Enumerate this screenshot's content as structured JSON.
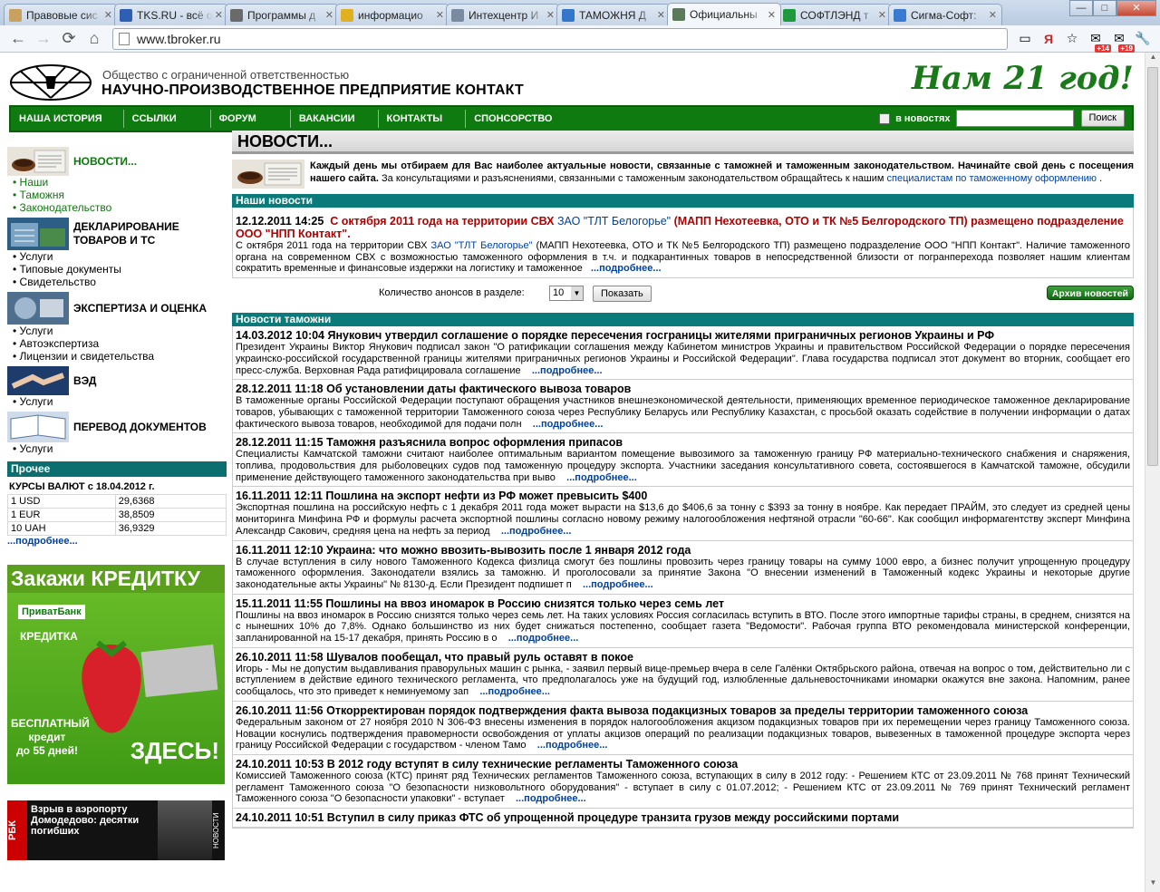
{
  "browser": {
    "tabs": [
      {
        "title": "Правовые сис",
        "color": "#c8a060"
      },
      {
        "title": "TKS.RU - всё о",
        "color": "#2e5fb3"
      },
      {
        "title": "Программы д",
        "color": "#6a6a6a"
      },
      {
        "title": "информацио",
        "color": "#e0b020"
      },
      {
        "title": "Интехцентр И",
        "color": "#7a8aa0"
      },
      {
        "title": "ТАМОЖНЯ Д",
        "color": "#3377cc"
      },
      {
        "title": "Официальны",
        "color": "#5a7a5a"
      },
      {
        "title": "СОФТЛЭНД т",
        "color": "#1c9a3c"
      },
      {
        "title": "Сигма-Софт:",
        "color": "#3a7ad0"
      }
    ],
    "url": "www.tbroker.ru",
    "badges": [
      "+14",
      "+19"
    ]
  },
  "header": {
    "org_type": "Общество с ограниченной ответственностью",
    "org_name": "НАУЧНО-ПРОИЗВОДСТВЕННОЕ ПРЕДПРИЯТИЕ КОНТАКТ",
    "slogan": "Нам 21 год!"
  },
  "menu": {
    "items": [
      "НАША ИСТОРИЯ",
      "ССЫЛКИ",
      "ФОРУМ",
      "ВАКАНСИИ",
      "КОНТАКТЫ",
      "СПОНСОРСТВО"
    ],
    "search_label": "в новостях",
    "search_button": "Поиск"
  },
  "sidebar": {
    "news_title": "НОВОСТИ...",
    "news_links": [
      "Наши",
      "Таможня",
      "Законодательство"
    ],
    "decl_title": "ДЕКЛАРИРОВАНИЕ ТОВАРОВ И ТС",
    "decl_links": [
      "Услуги",
      "Типовые документы",
      "Свидетельство"
    ],
    "exp_title": "ЭКСПЕРТИЗА И ОЦЕНКА",
    "exp_links": [
      "Услуги",
      "Автоэкспертиза",
      "Лицензии и свидетельства"
    ],
    "ved_title": "ВЭД",
    "ved_links": [
      "Услуги"
    ],
    "trans_title": "ПЕРЕВОД ДОКУМЕНТОВ",
    "trans_links": [
      "Услуги"
    ],
    "other_title": "Прочее",
    "rates_title": "КУРСЫ ВАЛЮТ с 18.04.2012 г.",
    "rates": [
      {
        "cur": "1 USD",
        "val": "29,6368"
      },
      {
        "cur": "1 EUR",
        "val": "38,8509"
      },
      {
        "cur": "10 UAH",
        "val": "36,9329"
      }
    ],
    "more": "...подробнее...",
    "ad1": {
      "title": "Закажи КРЕДИТКУ",
      "bank": "ПриватБанк",
      "card": "КРЕДИТКА",
      "free1": "БЕСПЛАТНЫЙ",
      "free2": "кредит",
      "free3": "до 55 дней!",
      "here": "ЗДЕСЬ!"
    },
    "ad2": {
      "brand": "РБК",
      "text": "Взрыв в аэропорту Домодедово: десятки погибших",
      "side": "НОВОСТИ"
    }
  },
  "main": {
    "title": "НОВОСТИ...",
    "intro_bold": "Каждый день мы отбираем для Вас наиболее актуальные новости, связанные с таможней и таможенным законодательством. Начинайте свой день с посещения нашего сайта.",
    "intro_rest": " За консультациями и разъяснениями, связанными с таможенным законодательством обращайтесь к нашим ",
    "intro_link": "специалистам по таможенному оформлению",
    "intro_end": " .",
    "our_news_title": "Наши новости",
    "our_news": {
      "date": "12.12.2011 14:25",
      "h1": "С октября 2011 года на территории СВХ",
      "h_link": "ЗАО \"ТЛТ Белогорье\"",
      "h2": "(МАПП Нехотеевка, ОТО и ТК №5 Белгородского ТП) размещено подразделение ООО \"НПП Контакт\".",
      "b1": "С октября 2011 года на территории СВХ ",
      "b_link": "ЗАО \"ТЛТ Белогорье\"",
      "b2": " (МАПП Нехотеевка, ОТО и ТК №5 Белгородского ТП) размещено подразделение ООО \"НПП Контакт\". Наличие таможенного органа на современном СВХ с возможностью таможенного оформления в т.ч. и подкарантинных товаров в непосредственной близости от погранперехода позволяет нашим клиентам сократить временные и финансовые издержки на логистику и таможенное",
      "more": "...подробнее..."
    },
    "count_label": "Количество анонсов в разделе:",
    "count_value": "10",
    "show_button": "Показать",
    "archive_button": "Архив новостей",
    "customs_title": "Новости таможни",
    "items": [
      {
        "h": "14.03.2012 10:04 Янукович утвердил соглашение о порядке пересечения госграницы жителями приграничных регионов Украины и РФ",
        "b": "Президент Украины Виктор Янукович подписал закон \"О ратификации соглашения между Кабинетом министров Украины и правительством Российской Федерации о порядке пересечения украинско-российской государственной границы жителями приграничных регионов Украины и Российской Федерации\". Глава государства подписал этот документ во вторник, сообщает его пресс-служба. Верховная Рада ратифицировала соглашение",
        "m": "...подробнее..."
      },
      {
        "h": "28.12.2011 11:18 Об установлении даты фактического вывоза товаров",
        "b": "В таможенные органы Российской Федерации поступают обращения участников внешнеэкономической деятельности, применяющих временное периодическое таможенное декларирование товаров, убывающих с таможенной территории Таможенного союза через Республику Беларусь или Республику Казахстан, с просьбой оказать содействие в получении информации о датах фактического вывоза товаров, необходимой для подачи полн",
        "m": "...подробнее..."
      },
      {
        "h": "28.12.2011 11:15 Таможня разъяснила вопрос оформления припасов",
        "b": "Специалисты Камчатской таможни считают наиболее оптимальным вариантом помещение вывозимого за таможенную границу РФ материально-технического снабжения и снаряжения, топлива, продовольствия для рыболовецких судов под таможенную процедуру экспорта. Участники заседания консультативного совета, состоявшегося в Камчатской таможне, обсудили применение действующего таможенного законодательства при выво",
        "m": "...подробнее..."
      },
      {
        "h": "16.11.2011 12:11 Пошлина на экспорт нефти из РФ может превысить $400",
        "b": "Экспортная пошлина на российскую нефть с 1 декабря 2011 года может вырасти на $13,6 до $406,6 за тонну с $393 за тонну в ноябре. Как передает ПРАЙМ, это следует из средней цены мониторинга Минфина РФ и формулы расчета экспортной пошлины согласно новому режиму налогообложения нефтяной отрасли \"60-66\". Как сообщил информагентству эксперт Минфина Александр Сакович, средняя цена на нефть за период",
        "m": "...подробнее..."
      },
      {
        "h": "16.11.2011 12:10 Украина: что можно ввозить-вывозить после 1 января 2012 года",
        "b": "В случае вступления в силу нового Таможенного Кодекса физлица смогут без пошлины провозить через границу товары на сумму 1000 евро, а бизнес получит упрощенную процедуру таможенного оформления. Законодатели взялись за таможню. И проголосовали за принятие Закона \"О внесении изменений в Таможенный кодекс Украины и некоторые другие законодательные акты Украины\" № 8130-д. Если Президент подпишет п",
        "m": "...подробнее..."
      },
      {
        "h": "15.11.2011 11:55 Пошлины на ввоз иномарок в Россию снизятся только через семь лет",
        "b": "Пошлины на ввоз иномарок в Россию снизятся только через семь лет. На таких условиях Россия согласилась вступить в ВТО. После этого импортные тарифы страны, в среднем, снизятся на с нынешних 10% до 7,8%. Однако большинство из них будет снижаться постепенно, сообщает газета \"Ведомости\". Рабочая группа ВТО рекомендовала министерской конференции, запланированной на 15-17 декабря, принять Россию в о",
        "m": "...подробнее..."
      },
      {
        "h": "26.10.2011 11:58 Шувалов пообещал, что правый руль оставят в покое",
        "b": "Игорь - Мы не допустим выдавливания праворульных машин с рынка, - заявил первый вице-премьер вчера в селе Галёнки Октябрьского района, отвечая на вопрос о том, действительно ли с вступлением в действие единого технического регламента, что предполагалось уже на будущий год, излюбленные дальневосточниками иномарки окажутся вне закона. Напомним, ранее сообщалось, что это приведет к неминуемому зап",
        "m": "...подробнее..."
      },
      {
        "h": "26.10.2011 11:56 Откорректирован порядок подтверждения факта вывоза подакцизных товаров за пределы территории таможенного союза",
        "b": "Федеральным законом от 27 ноября 2010 N 306-ФЗ внесены изменения в порядок налогообложения акцизом подакцизных товаров при их перемещении через границу Таможенного союза. Новации коснулись подтверждения правомерности освобождения от уплаты акцизов операций по реализации подакцизных товаров, вывезенных в таможенной процедуре экспорта через границу Российской Федерации с государством - членом Тамо",
        "m": "...подробнее..."
      },
      {
        "h": "24.10.2011 10:53 В 2012 году вступят в силу технические регламенты Таможенного союза",
        "b": "Комиссией Таможенного союза (КТС) принят ряд Технических регламентов Таможенного союза, вступающих в силу в 2012 году: - Решением КТС от 23.09.2011 № 768 принят Технический регламент Таможенного союза \"О безопасности низковольтного оборудования\" - вступает в силу с 01.07.2012; - Решением КТС от 23.09.2011 № 769 принят Технический регламент Таможенного союза \"О безопасности упаковки\" - вступает",
        "m": "...подробнее..."
      },
      {
        "h": "24.10.2011 10:51 Вступил в силу приказ ФТС об упрощенной процедуре транзита грузов между российскими портами",
        "b": "",
        "m": ""
      }
    ]
  }
}
